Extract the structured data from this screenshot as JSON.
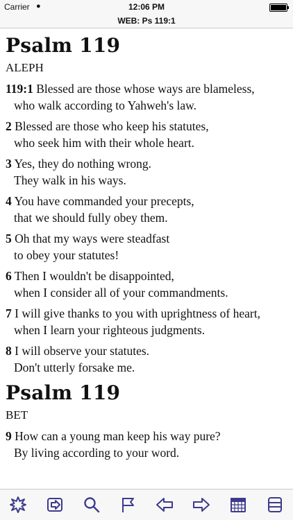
{
  "status": {
    "carrier": "Carrier",
    "time": "12:06 PM"
  },
  "nav": {
    "title": "WEB: Ps 119:1"
  },
  "sections": [
    {
      "heading": "Psalm 119",
      "label": "ALEPH",
      "verses": [
        {
          "num": "119:1",
          "first": " Blessed are those whose ways are blameless,",
          "second": "who walk according to Yahweh's law."
        },
        {
          "num": "2",
          "first": " Blessed are those who keep his statutes,",
          "second": "who seek him with their whole heart."
        },
        {
          "num": "3",
          "first": " Yes, they do nothing wrong.",
          "second": "They walk in his ways."
        },
        {
          "num": "4",
          "first": " You have commanded your precepts,",
          "second": "that we should fully obey them."
        },
        {
          "num": "5",
          "first": " Oh that my ways were steadfast",
          "second": "to obey your statutes!"
        },
        {
          "num": "6",
          "first": " Then I wouldn't be disappointed,",
          "second": "when I consider all of your commandments."
        },
        {
          "num": "7",
          "first": " I will give thanks to you with uprightness of heart,",
          "second": "when I learn your righteous judgments."
        },
        {
          "num": "8",
          "first": " I will observe your statutes.",
          "second": "Don't utterly forsake me."
        }
      ]
    },
    {
      "heading": "Psalm 119",
      "label": "BET",
      "verses": [
        {
          "num": "9",
          "first": " How can a young man keep his way pure?",
          "second": "By living according to your word."
        }
      ]
    }
  ],
  "toolbar": {
    "icons": [
      "starburst-icon",
      "go-to-icon",
      "search-icon",
      "flag-icon",
      "back-arrow-icon",
      "forward-arrow-icon",
      "calendar-icon",
      "list-icon"
    ]
  },
  "colors": {
    "toolbar_icon": "#3d3a8c"
  }
}
